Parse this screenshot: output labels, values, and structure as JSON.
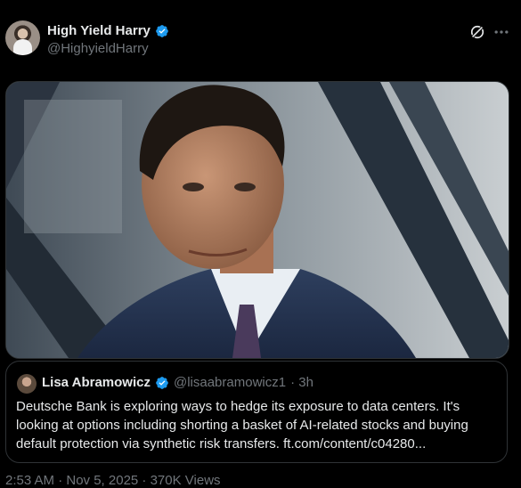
{
  "tweet": {
    "display_name": "High Yield Harry",
    "handle": "@HighyieldHarry",
    "media_alt": "Photo of a man in a suit"
  },
  "quote": {
    "display_name": "Lisa Abramowicz",
    "handle": "@lisaabramowicz1",
    "time": "· 3h",
    "text": "Deutsche Bank is exploring ways to hedge its exposure to data centers. It's looking at options including shorting a basket of AI-related stocks and buying default protection via synthetic risk transfers.",
    "link": "ft.com/content/c04280..."
  },
  "footer_partial": "2:53 AM · Nov 5, 2025 · 370K Views",
  "colors": {
    "background": "#000000",
    "text": "#e7e9ea",
    "secondary": "#71767b",
    "border": "#2f3336",
    "verified": "#1d9bf0"
  },
  "icons": {
    "grok": "grok-icon",
    "more": "more-icon",
    "verified": "verified-badge-icon"
  }
}
